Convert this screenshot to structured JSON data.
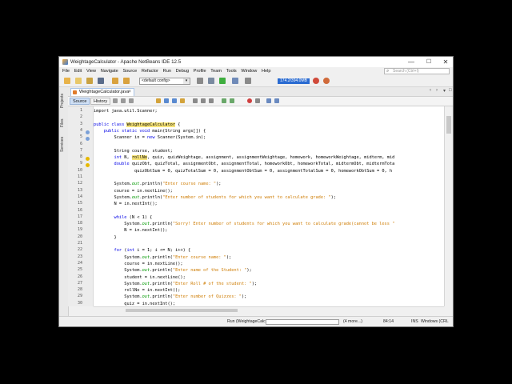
{
  "window": {
    "title": "WeightageCalculator - Apache NetBeans IDE 12.5",
    "minimize": "—",
    "maximize": "☐",
    "close": "✕"
  },
  "menu": [
    "File",
    "Edit",
    "View",
    "Navigate",
    "Source",
    "Refactor",
    "Run",
    "Debug",
    "Profile",
    "Team",
    "Tools",
    "Window",
    "Help"
  ],
  "search": {
    "placeholder": "Search (Ctrl+I)"
  },
  "toolbar": {
    "config": "<default config>",
    "memory": "174.2/394.0MB"
  },
  "side_tabs": [
    "Projects",
    "Files",
    "Services"
  ],
  "file_tab": {
    "label": "WeightageCalculator.java"
  },
  "editor_tabs": {
    "source": "Source",
    "history": "History"
  },
  "code_lines": [
    {
      "n": "1",
      "parts": [
        {
          "t": "import java.util.Scanner;",
          "c": ""
        }
      ]
    },
    {
      "n": "2",
      "parts": [
        {
          "t": "",
          "c": ""
        }
      ]
    },
    {
      "n": "3",
      "parts": [
        {
          "t": "public class ",
          "c": "kw"
        },
        {
          "t": "WeightageCalculator",
          "c": "hl"
        },
        {
          "t": " {",
          "c": ""
        }
      ]
    },
    {
      "n": "4",
      "parts": [
        {
          "t": "    public static void ",
          "c": "kw"
        },
        {
          "t": "main(String args[]) {",
          "c": ""
        }
      ]
    },
    {
      "n": "5",
      "parts": [
        {
          "t": "        Scanner in = ",
          "c": ""
        },
        {
          "t": "new ",
          "c": "kw"
        },
        {
          "t": "Scanner(System.in);",
          "c": ""
        }
      ]
    },
    {
      "n": "6",
      "parts": [
        {
          "t": "",
          "c": ""
        }
      ]
    },
    {
      "n": "7",
      "parts": [
        {
          "t": "        String course, student;",
          "c": ""
        }
      ]
    },
    {
      "n": "8",
      "parts": [
        {
          "t": "        int ",
          "c": "kw"
        },
        {
          "t": "N, ",
          "c": ""
        },
        {
          "t": "rollNo",
          "c": "hl"
        },
        {
          "t": ", quiz, quizWeightage, assignment, assignmentWeightage, homework, homeworkWeightage, midterm, mid",
          "c": ""
        }
      ]
    },
    {
      "n": "9",
      "parts": [
        {
          "t": "        double ",
          "c": "kw"
        },
        {
          "t": "quizObt, quizTotal, assignmentObt, assignmentTotal, homeworkObt, homeworkTotal, midtermObt, midtermTota",
          "c": ""
        }
      ]
    },
    {
      "n": "10",
      "parts": [
        {
          "t": "                quizObtSum = 0, quizTotalSum = 0, assignmentObtSum = 0, assignmentTotalSum = 0, homeworkObtSum = 0, h",
          "c": ""
        }
      ]
    },
    {
      "n": "11",
      "parts": [
        {
          "t": "",
          "c": ""
        }
      ]
    },
    {
      "n": "12",
      "parts": [
        {
          "t": "        System.",
          "c": ""
        },
        {
          "t": "out",
          "c": "fld"
        },
        {
          "t": ".println(",
          "c": ""
        },
        {
          "t": "\"Enter course name: \"",
          "c": "st"
        },
        {
          "t": ");",
          "c": ""
        }
      ]
    },
    {
      "n": "13",
      "parts": [
        {
          "t": "        course = in.nextLine();",
          "c": ""
        }
      ]
    },
    {
      "n": "14",
      "parts": [
        {
          "t": "        System.",
          "c": ""
        },
        {
          "t": "out",
          "c": "fld"
        },
        {
          "t": ".println(",
          "c": ""
        },
        {
          "t": "\"Enter number of students for which you want to calculate grade: \"",
          "c": "st"
        },
        {
          "t": ");",
          "c": ""
        }
      ]
    },
    {
      "n": "15",
      "parts": [
        {
          "t": "        N = in.nextInt();",
          "c": ""
        }
      ]
    },
    {
      "n": "16",
      "parts": [
        {
          "t": "",
          "c": ""
        }
      ]
    },
    {
      "n": "17",
      "parts": [
        {
          "t": "        while ",
          "c": "kw"
        },
        {
          "t": "(N < 1) {",
          "c": ""
        }
      ]
    },
    {
      "n": "18",
      "parts": [
        {
          "t": "            System.",
          "c": ""
        },
        {
          "t": "out",
          "c": "fld"
        },
        {
          "t": ".println(",
          "c": ""
        },
        {
          "t": "\"Sorry! Enter number of students for which you want to calculate grade(cannot be less \"",
          "c": "st"
        }
      ]
    },
    {
      "n": "19",
      "parts": [
        {
          "t": "            N = in.nextInt();",
          "c": ""
        }
      ]
    },
    {
      "n": "20",
      "parts": [
        {
          "t": "        }",
          "c": ""
        }
      ]
    },
    {
      "n": "21",
      "parts": [
        {
          "t": "",
          "c": ""
        }
      ]
    },
    {
      "n": "22",
      "parts": [
        {
          "t": "        for ",
          "c": "kw"
        },
        {
          "t": "(",
          "c": ""
        },
        {
          "t": "int ",
          "c": "kw"
        },
        {
          "t": "i = 1; i <= N; i++) {",
          "c": ""
        }
      ]
    },
    {
      "n": "23",
      "parts": [
        {
          "t": "            System.",
          "c": ""
        },
        {
          "t": "out",
          "c": "fld"
        },
        {
          "t": ".println(",
          "c": ""
        },
        {
          "t": "\"Enter course name: \"",
          "c": "st"
        },
        {
          "t": ");",
          "c": ""
        }
      ]
    },
    {
      "n": "24",
      "parts": [
        {
          "t": "            course = in.nextLine();",
          "c": ""
        }
      ]
    },
    {
      "n": "25",
      "parts": [
        {
          "t": "            System.",
          "c": ""
        },
        {
          "t": "out",
          "c": "fld"
        },
        {
          "t": ".println(",
          "c": ""
        },
        {
          "t": "\"Enter name of the Student: \"",
          "c": "st"
        },
        {
          "t": ");",
          "c": ""
        }
      ]
    },
    {
      "n": "26",
      "parts": [
        {
          "t": "            student = in.nextLine();",
          "c": ""
        }
      ]
    },
    {
      "n": "27",
      "parts": [
        {
          "t": "            System.",
          "c": ""
        },
        {
          "t": "out",
          "c": "fld"
        },
        {
          "t": ".println(",
          "c": ""
        },
        {
          "t": "\"Enter Roll # of the student: \"",
          "c": "st"
        },
        {
          "t": ");",
          "c": ""
        }
      ]
    },
    {
      "n": "28",
      "parts": [
        {
          "t": "            rollNo = in.nextInt();",
          "c": ""
        }
      ]
    },
    {
      "n": "29",
      "parts": [
        {
          "t": "            System.",
          "c": ""
        },
        {
          "t": "out",
          "c": "fld"
        },
        {
          "t": ".println(",
          "c": ""
        },
        {
          "t": "\"Enter number of Quizzes: \"",
          "c": "st"
        },
        {
          "t": ");",
          "c": ""
        }
      ]
    },
    {
      "n": "30",
      "parts": [
        {
          "t": "            quiz = in.nextInt();",
          "c": ""
        }
      ]
    }
  ],
  "status": {
    "run": "Run (WeightageCalculator)",
    "more": "(4 more...)",
    "position": "84:14",
    "ins": "INS",
    "eol": "Windows (CRL"
  },
  "colors": {
    "memory_bar": "#2a6bd1",
    "keyword": "#0000e6",
    "string": "#ce7b00",
    "highlight": "#f7e47a"
  }
}
